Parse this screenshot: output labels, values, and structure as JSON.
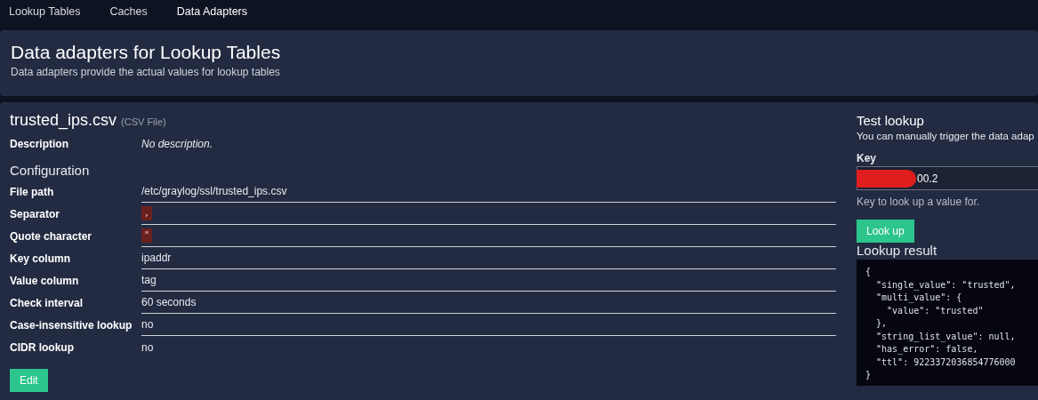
{
  "nav": {
    "items": [
      {
        "label": "Lookup Tables",
        "selected": false
      },
      {
        "label": "Caches",
        "selected": false
      },
      {
        "label": "Data Adapters",
        "selected": true
      }
    ]
  },
  "header": {
    "title": "Data adapters for Lookup Tables",
    "subtitle": "Data adapters provide the actual values for lookup tables"
  },
  "adapter": {
    "name": "trusted_ips.csv",
    "type": "(CSV File)",
    "description_label": "Description",
    "description": "No description.",
    "config_heading": "Configuration",
    "config": [
      {
        "label": "File path",
        "value": "/etc/graylog/ssl/trusted_ips.csv",
        "kind": "text"
      },
      {
        "label": "Separator",
        "value": ",",
        "kind": "code"
      },
      {
        "label": "Quote character",
        "value": "\"",
        "kind": "code"
      },
      {
        "label": "Key column",
        "value": "ipaddr",
        "kind": "text"
      },
      {
        "label": "Value column",
        "value": "tag",
        "kind": "text"
      },
      {
        "label": "Check interval",
        "value": "60 seconds",
        "kind": "text"
      },
      {
        "label": "Case-insensitive lookup",
        "value": "no",
        "kind": "text"
      },
      {
        "label": "CIDR lookup",
        "value": "no",
        "kind": "text"
      }
    ],
    "edit_button": "Edit"
  },
  "test_lookup": {
    "title": "Test lookup",
    "description": "You can manually trigger the data adap",
    "key_label": "Key",
    "key_value": "00.2",
    "key_redacted": true,
    "key_help": "Key to look up a value for.",
    "button": "Look up",
    "result_heading": "Lookup result",
    "result": "{\n  \"single_value\": \"trusted\",\n  \"multi_value\": {\n    \"value\": \"trusted\"\n  },\n  \"string_list_value\": null,\n  \"has_error\": false,\n  \"ttl\": 9223372036854776000\n}"
  }
}
